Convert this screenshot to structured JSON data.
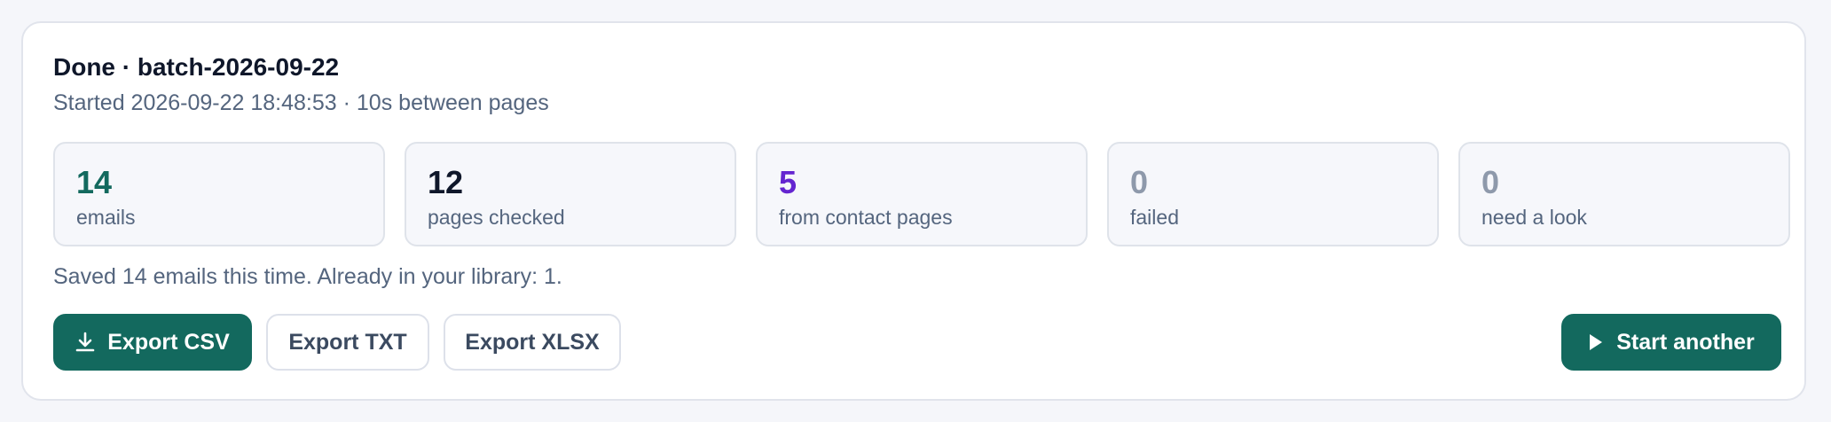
{
  "header": {
    "title": "Done · batch-2026-09-22",
    "subtitle": "Started 2026-09-22 18:48:53 · 10s between pages"
  },
  "stats": [
    {
      "value": "14",
      "label": "emails",
      "color": "#13695e"
    },
    {
      "value": "12",
      "label": "pages checked",
      "color": "#0f172a"
    },
    {
      "value": "5",
      "label": "from contact pages",
      "color": "#6425d0"
    },
    {
      "value": "0",
      "label": "failed",
      "color": "#8e99ab"
    },
    {
      "value": "0",
      "label": "need a look",
      "color": "#8e99ab"
    }
  ],
  "summary": "Saved 14 emails this time. Already in your library: 1.",
  "actions": {
    "export_csv": {
      "label": "Export CSV",
      "icon": "download-icon"
    },
    "export_txt": {
      "label": "Export TXT"
    },
    "export_xlsx": {
      "label": "Export XLSX"
    },
    "start_another": {
      "label": "Start another",
      "icon": "play-icon"
    }
  },
  "colors": {
    "accent": "#13695e",
    "purple": "#6425d0",
    "muted": "#54657e"
  }
}
